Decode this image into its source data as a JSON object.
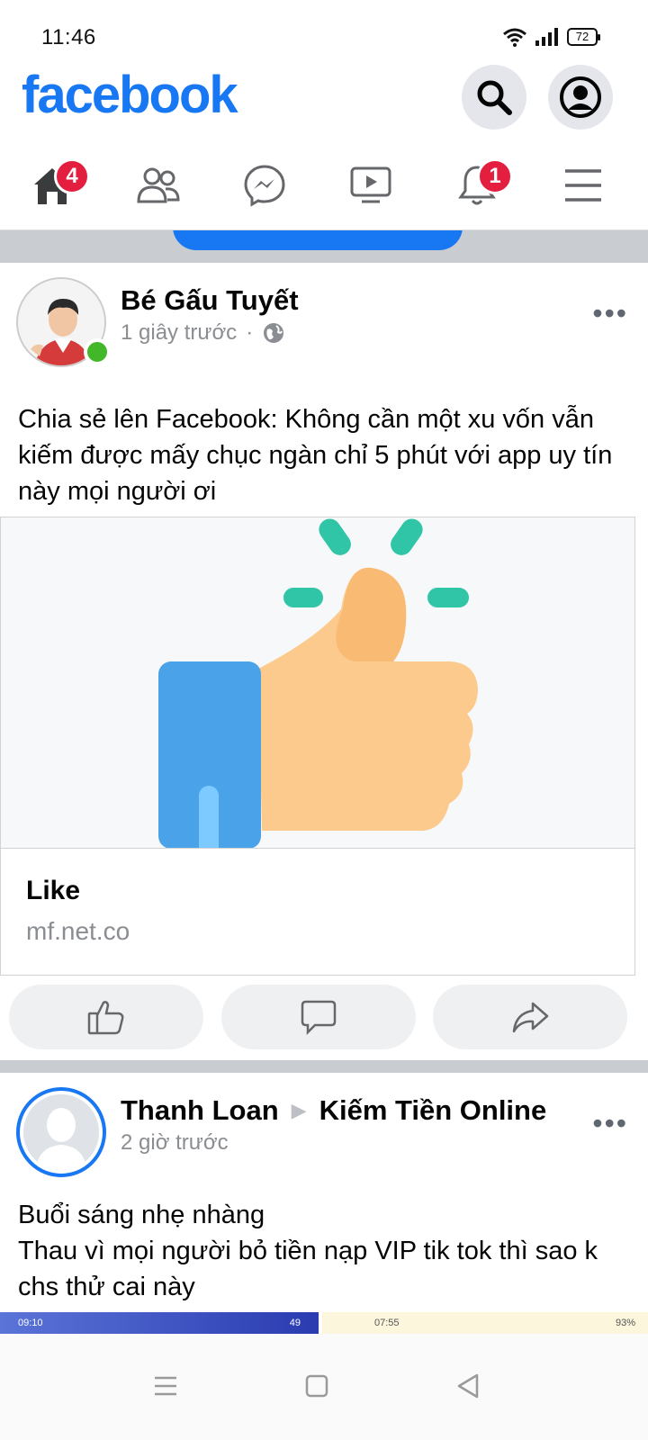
{
  "status_bar": {
    "time": "11:46",
    "battery": "72"
  },
  "header": {
    "logo": "facebook",
    "search_icon": "search-icon",
    "account_icon": "account-icon"
  },
  "tabs": [
    {
      "name": "home",
      "icon": "home-icon",
      "badge": "4",
      "active": true
    },
    {
      "name": "friends",
      "icon": "friends-icon",
      "badge": ""
    },
    {
      "name": "messenger",
      "icon": "messenger-icon",
      "badge": ""
    },
    {
      "name": "watch",
      "icon": "watch-icon",
      "badge": ""
    },
    {
      "name": "notifications",
      "icon": "bell-icon",
      "badge": "1"
    },
    {
      "name": "menu",
      "icon": "menu-icon",
      "badge": ""
    }
  ],
  "post1": {
    "author": "Bé Gấu Tuyết",
    "time": "1 giây trước",
    "separator": "·",
    "text": "Chia sẻ lên Facebook: Không cần một xu vốn vẫn kiếm được mấy chục ngàn chỉ 5 phút với app uy tín này mọi người ơi",
    "link": {
      "title": "Like",
      "domain": "mf.net.co"
    }
  },
  "post2": {
    "author": "Thanh Loan",
    "group": "Kiếm Tiền Online",
    "arrow": "▶",
    "time": "2 giờ trước",
    "text": "Buổi sáng nhẹ nhàng\n Thau vì mọi người bỏ tiền nạp VIP tik tok thì sao k chs thử cai này",
    "thumb_left_time": "09:10",
    "thumb_left_battery": "49",
    "thumb_right_time": "07:55",
    "thumb_right_battery": "93%"
  },
  "colors": {
    "brand": "#1877f2",
    "badge": "#e41e3f",
    "online": "#42b72a"
  }
}
